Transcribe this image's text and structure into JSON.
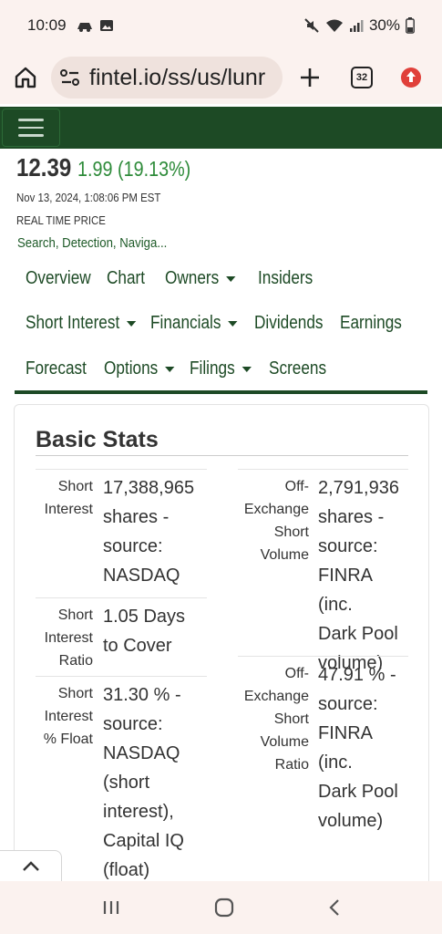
{
  "status_bar": {
    "time": "10:09",
    "battery": "30%"
  },
  "browser": {
    "url": "fintel.io/ss/us/lunr",
    "tab_count": "32"
  },
  "quote": {
    "price": "12.39",
    "change": "1.99 (19.13%)",
    "timestamp": "Nov 13, 2024, 1:08:06 PM EST",
    "price_type": "REAL TIME PRICE",
    "tags": "Search, Detection, Naviga..."
  },
  "nav": {
    "row1": [
      {
        "label": "Overview"
      },
      {
        "label": "Chart"
      },
      {
        "label": "Owners"
      },
      {
        "label": "Insiders"
      }
    ],
    "row2": [
      {
        "label": "Short Interest"
      },
      {
        "label": "Financials"
      },
      {
        "label": "Dividends"
      },
      {
        "label": "Earnings"
      }
    ],
    "row3": [
      {
        "label": "Forecast"
      },
      {
        "label": "Options"
      },
      {
        "label": "Filings"
      },
      {
        "label": "Screens"
      }
    ]
  },
  "basic_stats": {
    "title": "Basic Stats",
    "left": [
      {
        "label": [
          "Short",
          "Interest"
        ],
        "value": [
          "17,388,965",
          "shares -",
          "source:",
          "NASDAQ"
        ]
      },
      {
        "label": [
          "Short",
          "Interest",
          "Ratio"
        ],
        "value": [
          "1.05 Days",
          "to Cover"
        ]
      },
      {
        "label": [
          "Short",
          "Interest",
          "% Float"
        ],
        "value": [
          "31.30 % -",
          "source:",
          "NASDAQ",
          "(short",
          "interest),",
          "Capital IQ",
          "(float)"
        ]
      }
    ],
    "right": [
      {
        "label": [
          "Off-",
          "Exchange",
          "Short",
          "Volume"
        ],
        "value": [
          "2,791,936",
          "shares -",
          "source:",
          "FINRA (inc.",
          "Dark Pool",
          "volume)"
        ]
      },
      {
        "label": [
          "Off-",
          "Exchange",
          "Short",
          "Volume",
          "Ratio"
        ],
        "value": [
          "47.91 % -",
          "source:",
          "FINRA (inc.",
          "Dark Pool",
          "volume)"
        ]
      }
    ]
  }
}
